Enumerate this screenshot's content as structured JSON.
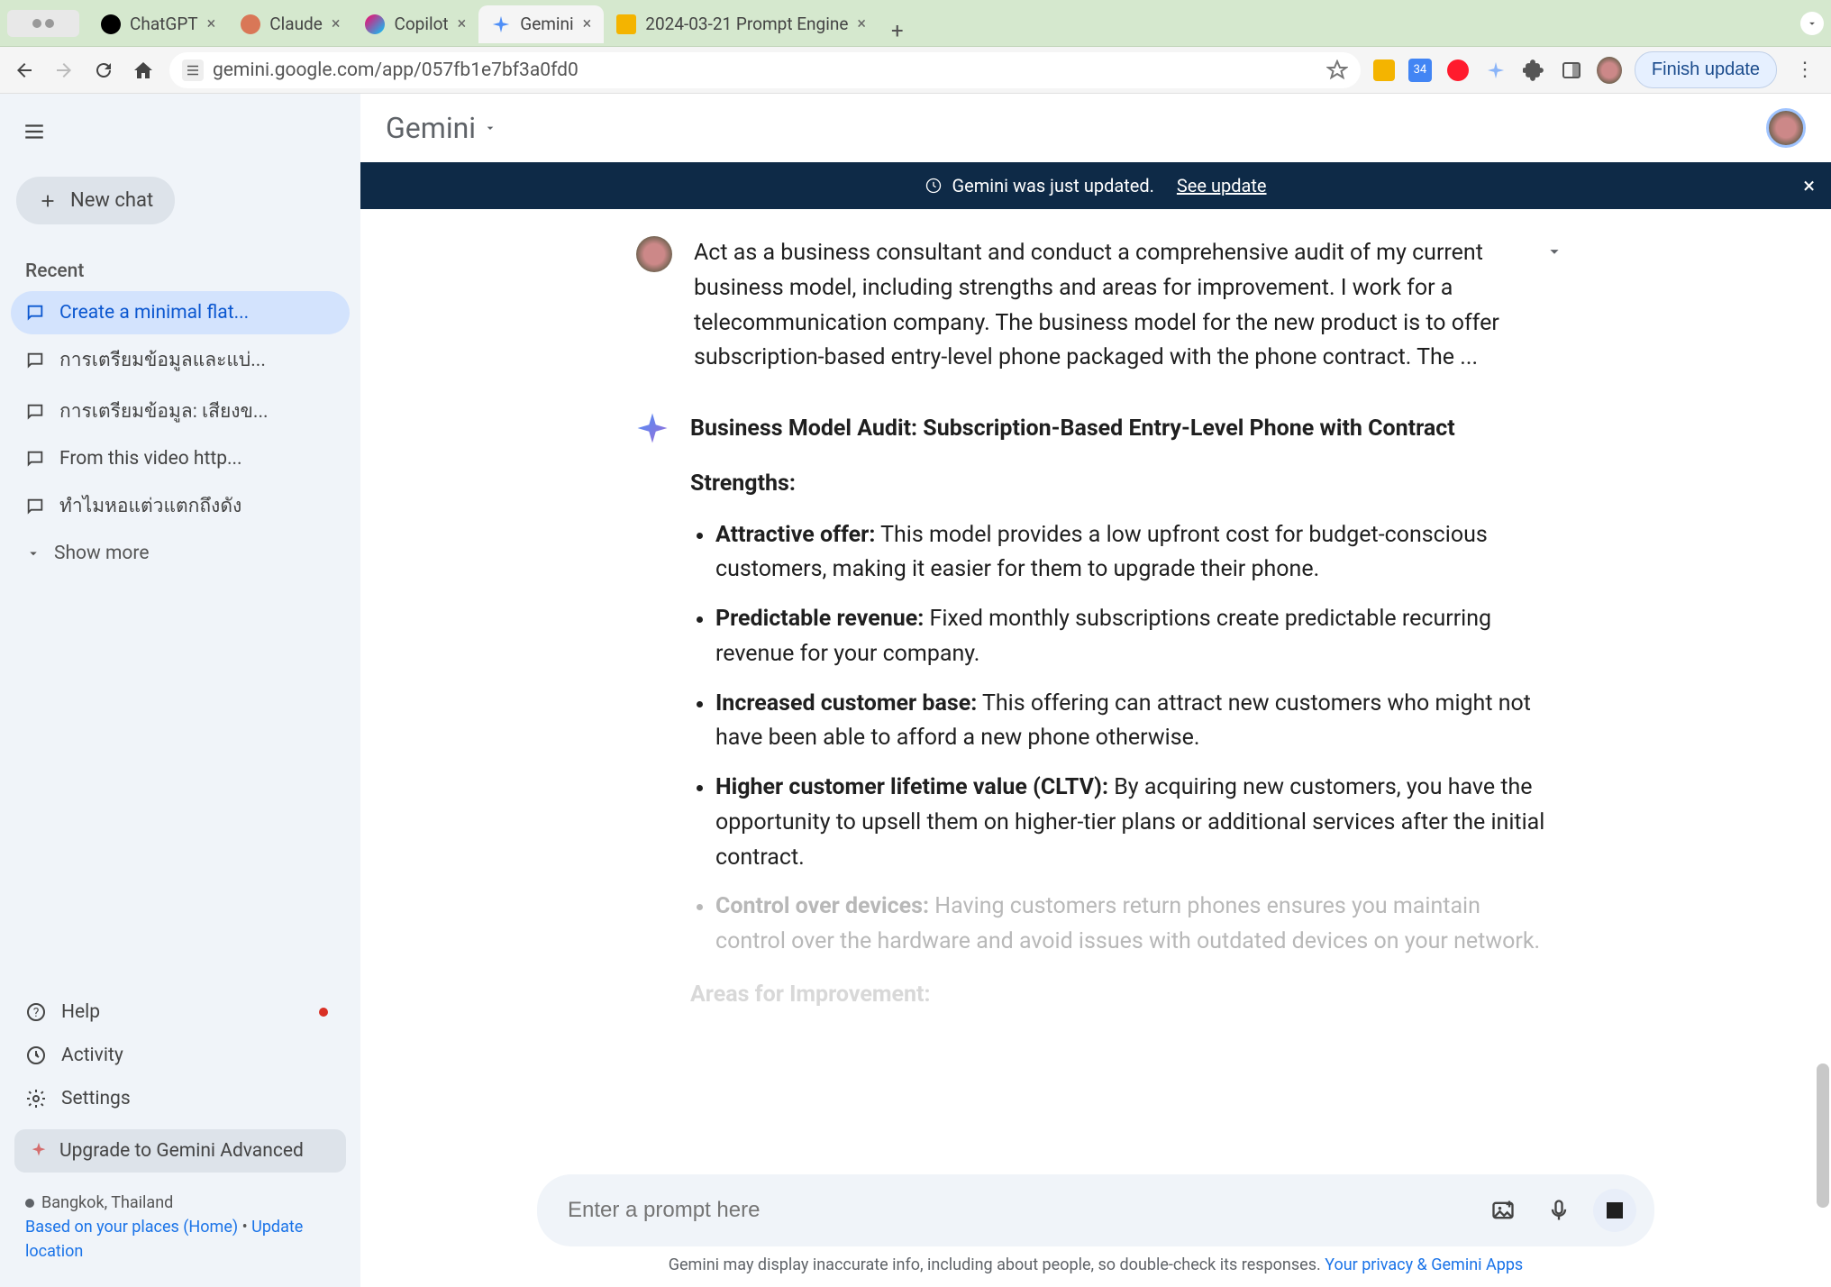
{
  "browser": {
    "tabs": [
      {
        "label": "ChatGPT",
        "favicon_color": "#000"
      },
      {
        "label": "Claude",
        "favicon_color": "#d97757"
      },
      {
        "label": "Copilot",
        "favicon_color": "linear"
      },
      {
        "label": "Gemini",
        "favicon_color": "#4f8ff7",
        "active": true
      },
      {
        "label": "2024-03-21 Prompt Engine",
        "favicon_color": "#f4b400"
      }
    ],
    "url": "gemini.google.com/app/057fb1e7bf3a0fd0",
    "finish_update_label": "Finish update",
    "calendar_badge": "34"
  },
  "sidebar": {
    "new_chat_label": "New chat",
    "recent_label": "Recent",
    "chats": [
      {
        "label": "Create a minimal flat...",
        "active": true
      },
      {
        "label": "การเตรียมข้อมูลและแบ่..."
      },
      {
        "label": "การเตรียมข้อมูล: เสียงข..."
      },
      {
        "label": "From this video http..."
      },
      {
        "label": "ทำไมหอแต่วแตกถึงดัง"
      }
    ],
    "show_more_label": "Show more",
    "help_label": "Help",
    "activity_label": "Activity",
    "settings_label": "Settings",
    "upgrade_label": "Upgrade to Gemini Advanced",
    "location": {
      "city": "Bangkok, Thailand",
      "line2_prefix": "Based on your places (Home)",
      "update_label": "Update location"
    }
  },
  "header": {
    "app_name": "Gemini"
  },
  "banner": {
    "text": "Gemini was just updated.",
    "link_text": "See update"
  },
  "conversation": {
    "user_prompt": "Act as a business consultant and conduct a comprehensive audit of my current business model, including strengths and areas for improvement. I work for a telecommunication company. The business model for the new product is to offer subscription-based entry-level phone packaged with the phone contract. The ...",
    "response": {
      "title": "Business Model Audit: Subscription-Based Entry-Level Phone with Contract",
      "strengths_label": "Strengths:",
      "strengths": [
        {
          "b": "Attractive offer:",
          "t": " This model provides a low upfront cost for budget-conscious customers, making it easier for them to upgrade their phone."
        },
        {
          "b": "Predictable revenue:",
          "t": " Fixed monthly subscriptions create predictable recurring revenue for your company."
        },
        {
          "b": "Increased customer base:",
          "t": " This offering can attract new customers who might not have been able to afford a new phone otherwise."
        },
        {
          "b": "Higher customer lifetime value (CLTV):",
          "t": " By acquiring new customers, you have the opportunity to upsell them on higher-tier plans or additional services after the initial contract."
        },
        {
          "b": "Control over devices:",
          "t": " Having customers return phones ensures you maintain control over the hardware and avoid issues with outdated devices on your network."
        }
      ],
      "areas_label": "Areas for Improvement:"
    }
  },
  "input": {
    "placeholder": "Enter a prompt here"
  },
  "disclaimer": {
    "text": "Gemini may display inaccurate info, including about people, so double-check its responses.",
    "link": "Your privacy & Gemini Apps"
  }
}
